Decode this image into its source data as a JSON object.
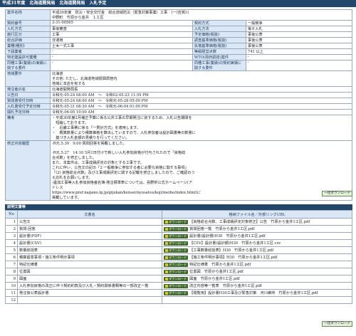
{
  "header": {
    "title": "平成31年度　北海道開発局　北海道開発局　入札予定"
  },
  "info_rows": [
    {
      "label": "案件名称",
      "value": "平成30年度　防災・安全交付金　総合流域防災（緊急対策事業）工事　(一)吉賀川\n中野町　竹原から金井　１工区",
      "span": true
    },
    {
      "label": "契約番号",
      "value": "3-31-00565",
      "label2": "契約方式",
      "value2": "一般競争"
    },
    {
      "label": "入札方式",
      "value": "事後審査",
      "label2": "入札方法",
      "value2": "電子入札"
    },
    {
      "label": "施行区分",
      "value": "工事",
      "label2": "予定価格(税抜)",
      "value2": "事後公表"
    },
    {
      "label": "総合評価",
      "value": "非適用",
      "label2": "調査基準価格(税抜)",
      "value2": "事後公表"
    },
    {
      "label": "業種(種別)",
      "value": "土木一式工事",
      "label2": "失格基準価格(税抜)",
      "value2": "事後公表"
    },
    {
      "label": "下請業者",
      "value": "-",
      "label2": "等級経営点数",
      "value2": "741 以上"
    },
    {
      "label": "特定建設許可業種",
      "value": "-",
      "label2": "WTO(政府調達)案件",
      "value2": "-"
    },
    {
      "label": "同種工事(業績)の実績に関する要件",
      "value": "-",
      "label2": "同種工事(業績)の契約実績に関する要件",
      "value2": "-"
    },
    {
      "label": "地域要件",
      "value": "北海道\nその他: ただし、北海道地域振興局管内\n地域に本店を有する",
      "span": true
    },
    {
      "label": "発注者の名",
      "value": "北海道開発局長",
      "span": true
    },
    {
      "label": "公告日",
      "value": "令和元-05-24 08:00 AM　～　令和02-05-23 11:59 PM",
      "span": true
    },
    {
      "label": "質問書受付日時",
      "value": "令和元-05-24 08:00 AM　～　令和元-05-28 05:00 PM",
      "span": true
    },
    {
      "label": "入札書受付予定日時",
      "value": "令和元-05-31 08:30 AM　～　令和元-06-04 01:00 PM",
      "span": true
    },
    {
      "label": "開札予定日時",
      "value": "令和元-06-05 10:00 AM",
      "span": true
    },
    {
      "label": "備考",
      "value": "・平成30年度2月補正予算に係る公共工事の早期発注に資するため、入札公告期間を\n　短縮しております。\n・　近畿工事費に係る「一貫計方式」を適用します。\n・　概算数量により積算価格を算出していますので、入札参加者は設計図書等の数量に\n　基づき入札金額の見積りを行ってください。",
      "span": true
    },
    {
      "label": "修正内容履歴",
      "value": "-R元.5.30　9:00 質問回答を掲載しました。\n\n-R元.5.27　14:10 5月1日付けで新しい入札参加資格が付与されたので「資格総\n合点数」を修正しました。\nまた、本案件は、工事成績評定の対象とする工事です。\nこれに伴い、公告文の記の「2 一般競争に参加する者に必要な資格に関する事項」\n「(2) 資格総合点数」及び工事成績評定に関する記載を修正しましたので、ご確認のう\nえ応札をお願いします。\n-遺加工事等入札参加資格者名簿-発注標準表については、島野県公式ホームページ(ア\nドレス\nhttps://www.pref.nagano.lg.jp/gijukan/kensei/nyusatsu/koji/meibo/index.html)に\n掲載しています。",
      "span": true
    }
  ],
  "download_all_label": "一括ダウンロード",
  "docs_section": {
    "title": "説明文書等",
    "headers": [
      "No",
      "文書名",
      "格納ファイル名／外部リンクURL"
    ],
    "download_label": "ダウンロード",
    "rows": [
      {
        "no": "1",
        "name": "公告文",
        "file": "【資格総合点数、工事成績評定対象修正】公告　竹原から金井1工区.pdf"
      },
      {
        "no": "2",
        "name": "質問-回答",
        "file": "質問回答一覧　竹原から金井1工区.pdf"
      },
      {
        "no": "3",
        "name": "設計書(PDF)",
        "file": "設計書(設計額)H30　竹原から金井1工区.pdf"
      },
      {
        "no": "4",
        "name": "設計書(CSV)",
        "file": "【CSV】設計書(設計額)H30　竹原から金井1工区.csv"
      },
      {
        "no": "5",
        "name": "数量総括表",
        "file": "【工事数量総括表】H30　竹原から金井1工区.pdf"
      },
      {
        "no": "6",
        "name": "積算留意事項・施工条件明示事項",
        "file": "【施工条件明示事項】H30　竹原から金井1工区.pdf"
      },
      {
        "no": "7",
        "name": "特記仕様書",
        "file": "特記仕様書　竹原から金井1工区.pdf"
      },
      {
        "no": "8",
        "name": "位置図",
        "file": "位置図　竹原から金井1工区.pdf"
      },
      {
        "no": "9",
        "name": "図面",
        "file": "図面　竹原から金井1工区.pdf"
      },
      {
        "no": "10",
        "name": "入札参加資格の改正に伴う契約約款及び入札・契約関係書類等の一部改正一覧",
        "file": "改正内容等一覧表　竹原から金井1工区.pdf"
      },
      {
        "no": "11",
        "name": "発注後公表設計書",
        "file": "【閲覧用】設計書H30工事及び緊急対策　河川維持　竹原から金井1工区.pdf"
      },
      {
        "no": "12",
        "name": "",
        "file": ""
      }
    ]
  }
}
